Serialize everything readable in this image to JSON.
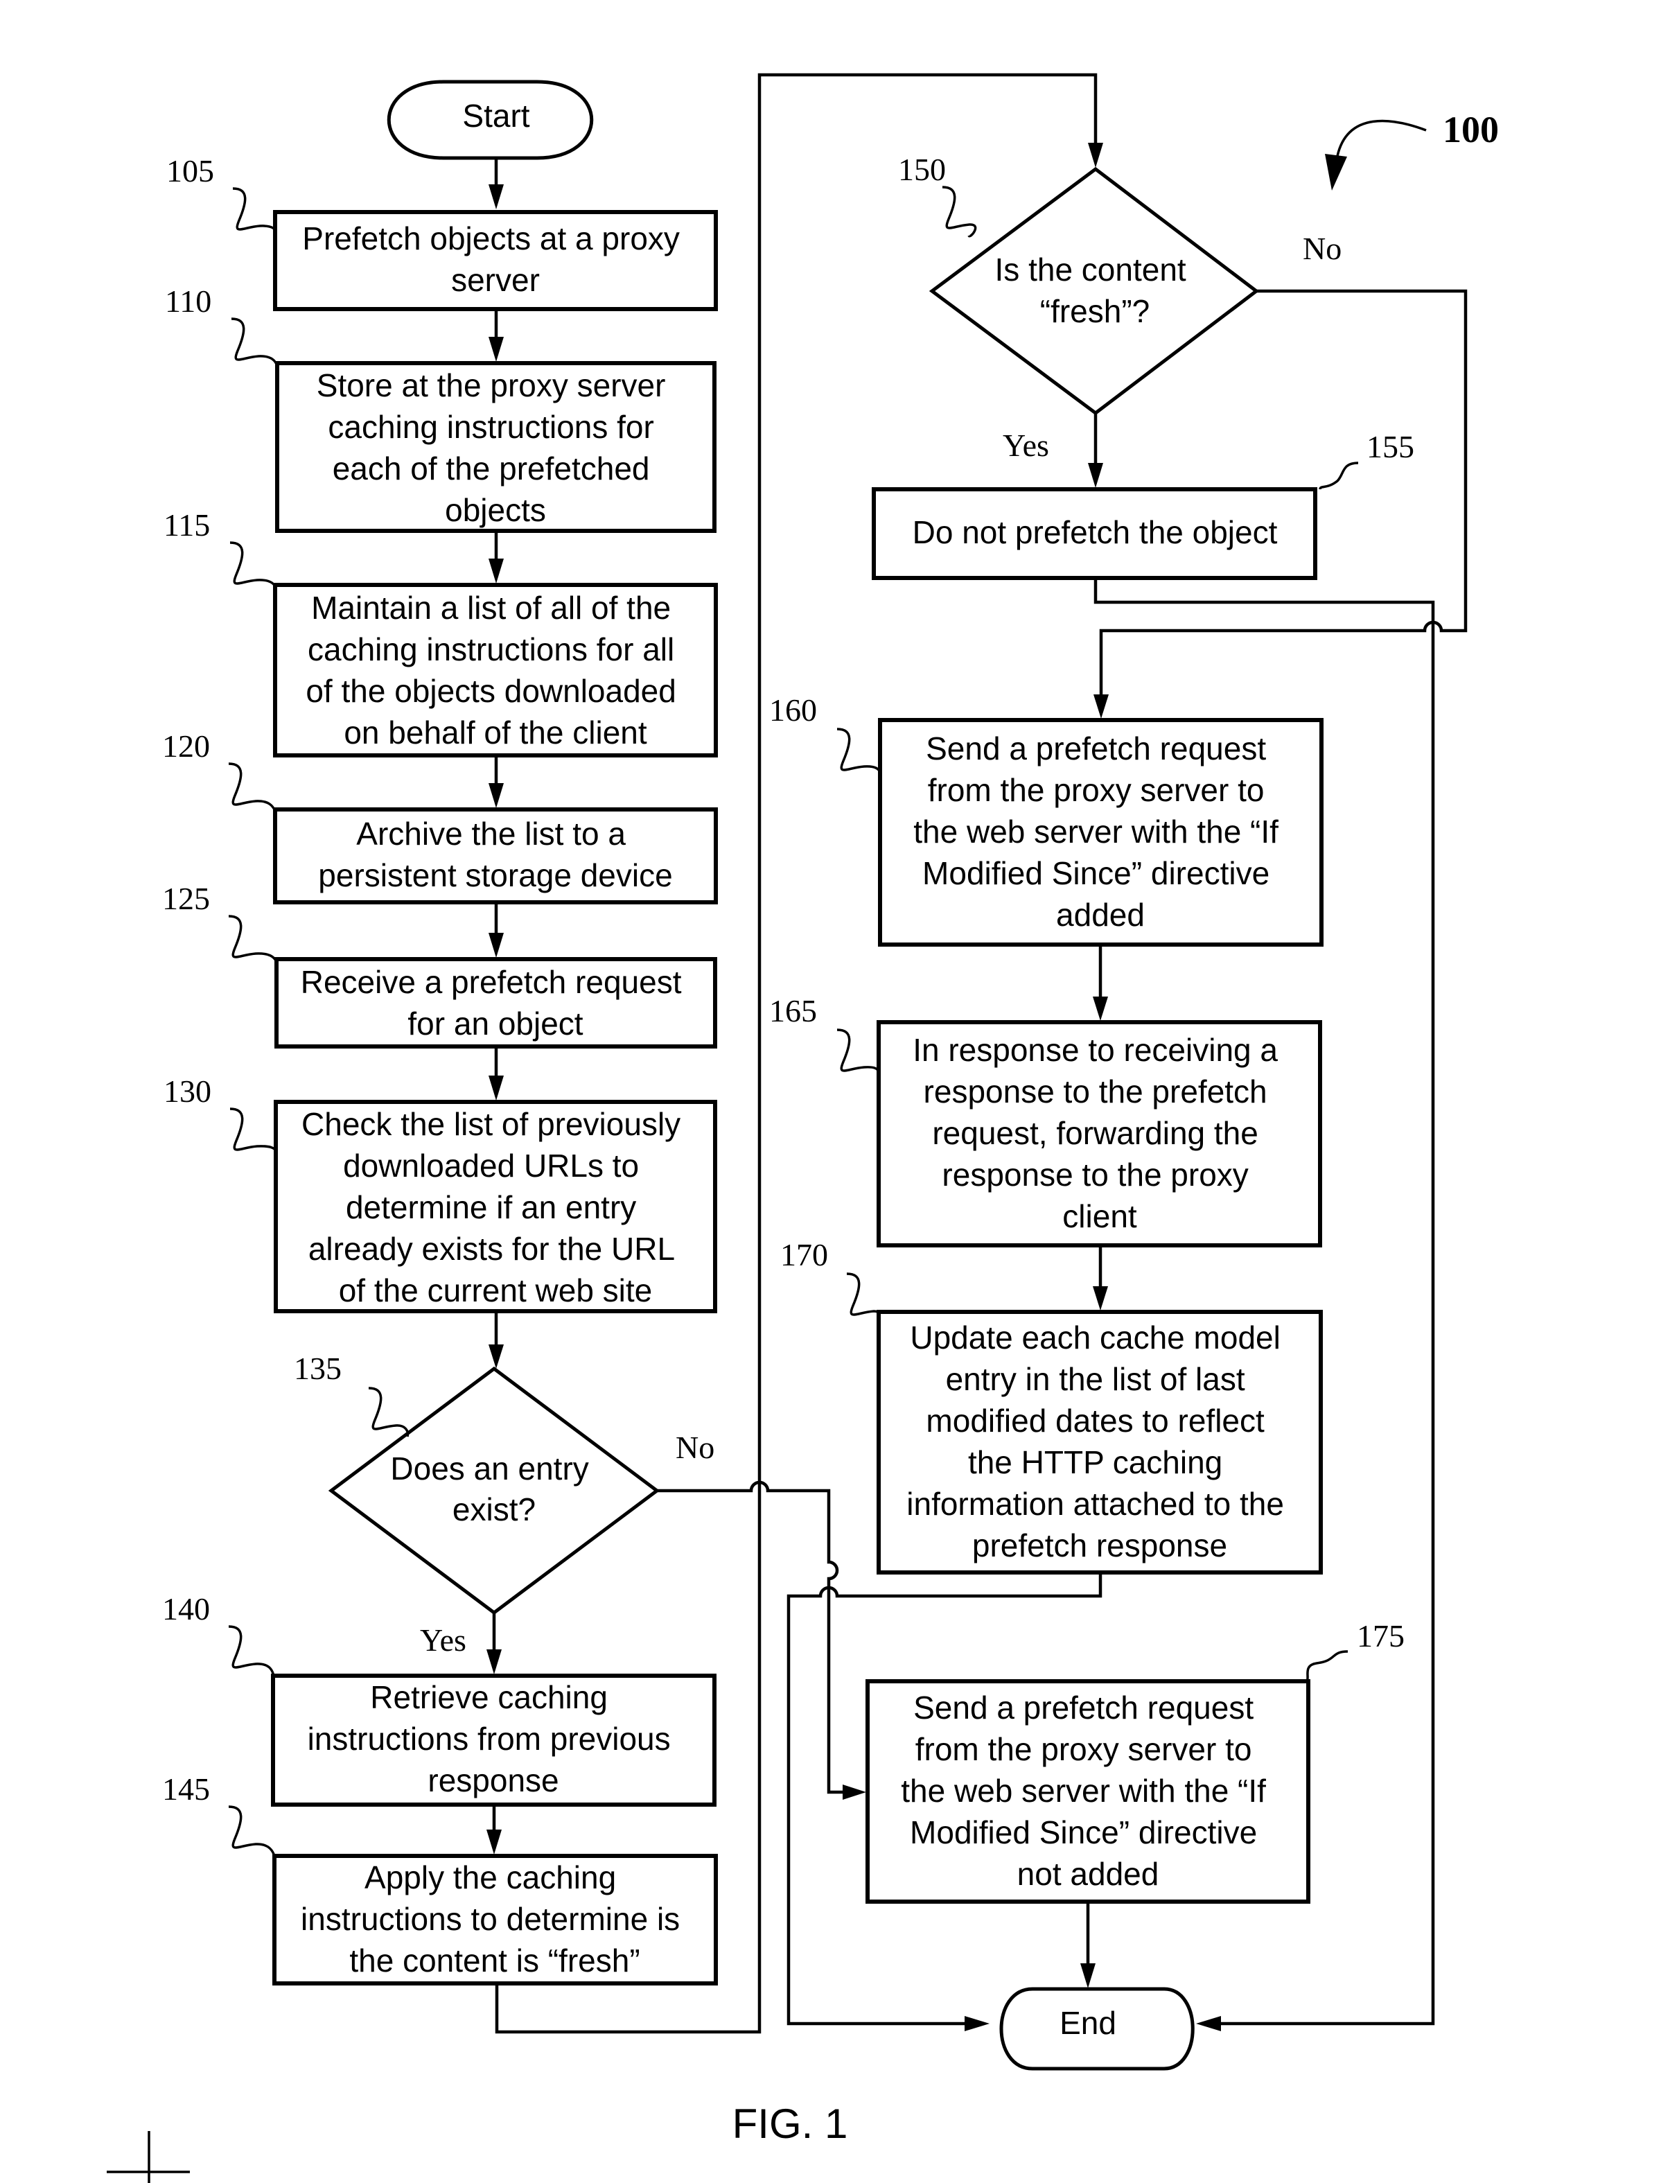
{
  "figure": {
    "title": "FIG. 1",
    "diagram_ref": "100"
  },
  "terminals": {
    "start": "Start",
    "end": "End"
  },
  "steps": [
    {
      "ref": "105",
      "lines": [
        "Prefetch objects at a proxy",
        "server"
      ]
    },
    {
      "ref": "110",
      "lines": [
        "Store at the proxy server",
        "caching instructions for",
        "each of the prefetched",
        "objects"
      ]
    },
    {
      "ref": "115",
      "lines": [
        "Maintain a list of all of the",
        "caching instructions for all",
        "of the objects downloaded",
        "on behalf of the client"
      ]
    },
    {
      "ref": "120",
      "lines": [
        "Archive the list to a",
        "persistent storage device"
      ]
    },
    {
      "ref": "125",
      "lines": [
        "Receive a prefetch request",
        "for an object"
      ]
    },
    {
      "ref": "130",
      "lines": [
        "Check the list of previously",
        "downloaded URLs to",
        "determine if an entry",
        "already exists for the URL",
        "of the current web site"
      ]
    },
    {
      "ref": "135",
      "lines": [
        "Does an entry",
        "exist?"
      ],
      "type": "decision"
    },
    {
      "ref": "140",
      "lines": [
        "Retrieve caching",
        "instructions from previous",
        "response"
      ]
    },
    {
      "ref": "145",
      "lines": [
        "Apply the caching",
        "instructions to determine is",
        "the content is “fresh”"
      ]
    },
    {
      "ref": "150",
      "lines": [
        "Is the content",
        "“fresh”?"
      ],
      "type": "decision"
    },
    {
      "ref": "155",
      "lines": [
        "Do not prefetch the object"
      ]
    },
    {
      "ref": "160",
      "lines": [
        "Send a prefetch request",
        "from the proxy server to",
        "the web server with the “If",
        "Modified Since” directive",
        "added"
      ]
    },
    {
      "ref": "165",
      "lines": [
        "In response to receiving a",
        "response to the prefetch",
        "request, forwarding the",
        "response to the proxy",
        "client"
      ]
    },
    {
      "ref": "170",
      "lines": [
        "Update each cache model",
        "entry in the list of last",
        "modified dates to reflect",
        "the HTTP caching",
        "information attached to the",
        "prefetch response"
      ]
    },
    {
      "ref": "175",
      "lines": [
        "Send a prefetch request",
        "from the proxy server to",
        "the web server with the “If",
        "Modified Since” directive",
        "not added"
      ]
    }
  ],
  "branch_labels": {
    "d135_yes": "Yes",
    "d135_no": "No",
    "d150_yes": "Yes",
    "d150_no": "No"
  }
}
